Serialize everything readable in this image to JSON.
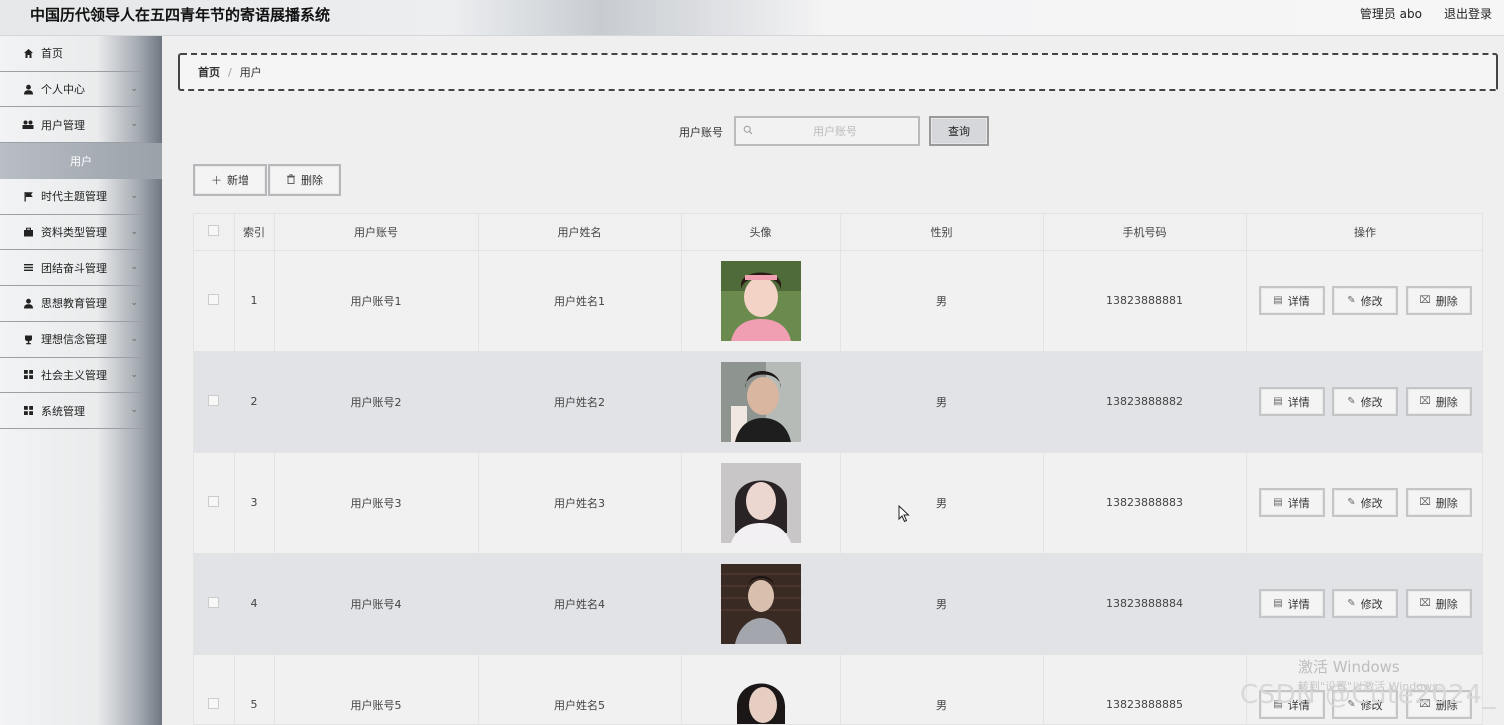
{
  "header": {
    "title": "中国历代领导人在五四青年节的寄语展播系统",
    "user": "管理员 abo",
    "logout": "退出登录"
  },
  "sidebar": {
    "items": [
      {
        "label": "首页",
        "icon": "home-icon",
        "chevron": false
      },
      {
        "label": "个人中心",
        "icon": "user-icon",
        "chevron": true
      },
      {
        "label": "用户管理",
        "icon": "users-icon",
        "chevron": true
      },
      {
        "label": "时代主题管理",
        "icon": "flag-icon",
        "chevron": true
      },
      {
        "label": "资料类型管理",
        "icon": "briefcase-icon",
        "chevron": true
      },
      {
        "label": "团结奋斗管理",
        "icon": "list-icon",
        "chevron": true
      },
      {
        "label": "思想教育管理",
        "icon": "person-icon",
        "chevron": true
      },
      {
        "label": "理想信念管理",
        "icon": "trophy-icon",
        "chevron": true
      },
      {
        "label": "社会主义管理",
        "icon": "grid-icon",
        "chevron": true
      },
      {
        "label": "系统管理",
        "icon": "grid-icon",
        "chevron": true
      }
    ],
    "submenu_active": "用户"
  },
  "breadcrumb": {
    "home": "首页",
    "current": "用户"
  },
  "search": {
    "label": "用户账号",
    "placeholder": "用户账号",
    "button": "查询"
  },
  "actions": {
    "add": "新增",
    "delete": "删除"
  },
  "table": {
    "columns": [
      "索引",
      "用户账号",
      "用户姓名",
      "头像",
      "性别",
      "手机号码",
      "操作"
    ],
    "rows": [
      {
        "index": "1",
        "account": "用户账号1",
        "name": "用户姓名1",
        "gender": "男",
        "phone": "13823888881"
      },
      {
        "index": "2",
        "account": "用户账号2",
        "name": "用户姓名2",
        "gender": "男",
        "phone": "13823888882"
      },
      {
        "index": "3",
        "account": "用户账号3",
        "name": "用户姓名3",
        "gender": "男",
        "phone": "13823888883"
      },
      {
        "index": "4",
        "account": "用户账号4",
        "name": "用户姓名4",
        "gender": "男",
        "phone": "13823888884"
      },
      {
        "index": "5",
        "account": "用户账号5",
        "name": "用户姓名5",
        "gender": "男",
        "phone": "13823888885"
      }
    ],
    "row_actions": {
      "detail": "详情",
      "edit": "修改",
      "delete": "删除"
    }
  },
  "watermark": {
    "line1": "激活 Windows",
    "line2": "转到\"设置\"以激活 Windows。",
    "csdn": "CSDN @Cute2024_"
  }
}
